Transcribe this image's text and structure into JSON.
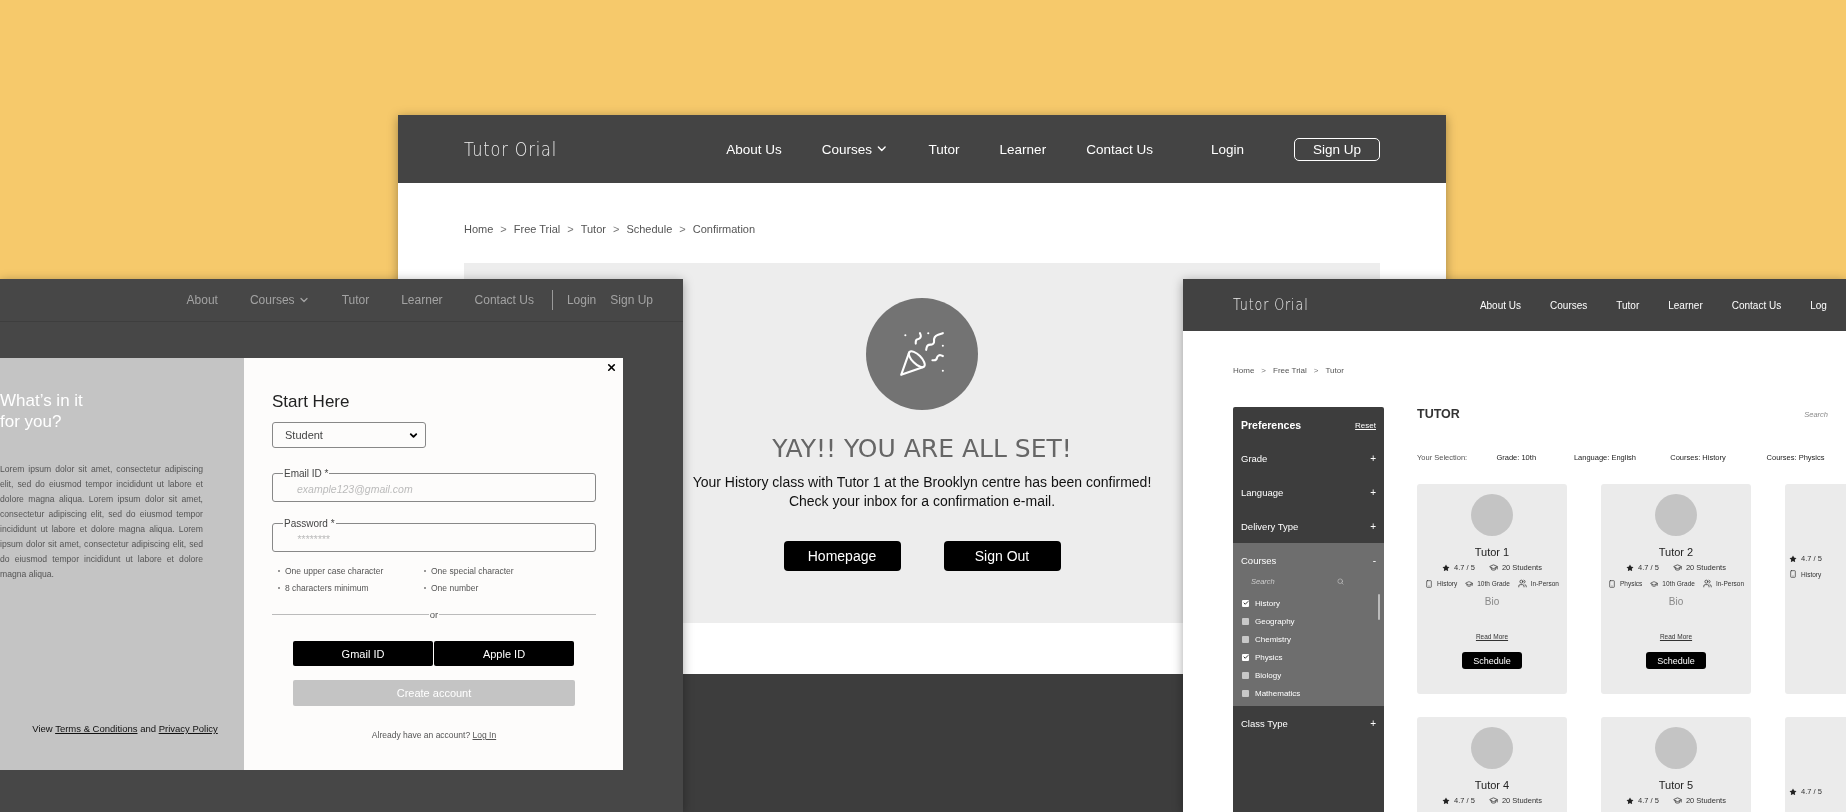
{
  "confirmation_page": {
    "logo": "Tutor Orial",
    "nav": [
      {
        "label": "About Us",
        "kind": "link"
      },
      {
        "label": "Courses",
        "kind": "dropdown"
      },
      {
        "label": "Tutor",
        "kind": "link"
      },
      {
        "label": "Learner",
        "kind": "link"
      },
      {
        "label": "Contact Us",
        "kind": "link"
      }
    ],
    "login": "Login",
    "signup": "Sign Up",
    "breadcrumb": [
      {
        "label": "Home",
        "kind": "link"
      },
      {
        "label": ">",
        "kind": "separator"
      },
      {
        "label": "Free Trial",
        "kind": "link"
      },
      {
        "label": ">",
        "kind": "separator"
      },
      {
        "label": "Tutor",
        "kind": "link"
      },
      {
        "label": ">",
        "kind": "separator"
      },
      {
        "label": "Schedule",
        "kind": "link"
      },
      {
        "label": ">",
        "kind": "separator"
      },
      {
        "label": "Confirmation",
        "kind": "link"
      }
    ],
    "title": "YAY!! YOU ARE ALL SET!",
    "message": [
      "Your History class with Tutor 1 at the Brooklyn centre has been confirmed!",
      "Check your inbox for a confirmation e-mail."
    ],
    "buttons": [
      "Homepage",
      "Sign Out"
    ]
  },
  "signup_page": {
    "nav": [
      {
        "label": "About",
        "kind": "link"
      },
      {
        "label": "Courses",
        "kind": "dropdown"
      },
      {
        "label": "Tutor",
        "kind": "link"
      },
      {
        "label": "Learner",
        "kind": "link"
      },
      {
        "label": "Contact Us",
        "kind": "link"
      }
    ],
    "login": "Login",
    "signup": "Sign Up",
    "promo": {
      "heading": [
        "What’s in it",
        "for you?"
      ],
      "body": "Lorem ipsum dolor sit amet, consectetur adipiscing elit, sed do eiusmod tempor incididunt ut labore et dolore magna aliqua. Lorem ipsum dolor sit amet, consectetur adipiscing elit, sed do eiusmod tempor incididunt ut labore et dolore magna aliqua. Lorem ipsum dolor sit amet, consectetur adipiscing elit, sed do eiusmod tempor incididunt ut labore et dolore magna aliqua.",
      "legal": {
        "before": "View",
        "terms": "Terms & Conditions",
        "middle": "and",
        "privacy": "Privacy Policy"
      }
    },
    "form": {
      "title": "Start Here",
      "role": "Student",
      "email": {
        "label": "Email ID *",
        "placeholder": "example123@gmail.com"
      },
      "password": {
        "label": "Password *",
        "placeholder": "********"
      },
      "rules": [
        "One upper case character",
        "One special character",
        "8 characters minimum",
        "One number"
      ],
      "divider": "or",
      "social": [
        "Gmail ID",
        "Apple ID"
      ],
      "submit": {
        "label": "Create account",
        "disabled": true
      },
      "login_prompt": "Already have an account?",
      "login_link": "Log In"
    }
  },
  "tutor_page": {
    "logo": "Tutor Orial",
    "nav": [
      "About Us",
      "Courses",
      "Tutor",
      "Learner",
      "Contact Us",
      "Log"
    ],
    "breadcrumb": [
      {
        "label": "Home",
        "kind": "link"
      },
      {
        "label": ">",
        "kind": "separator"
      },
      {
        "label": "Free Trial",
        "kind": "link"
      },
      {
        "label": ">",
        "kind": "separator"
      },
      {
        "label": "Tutor",
        "kind": "link"
      }
    ],
    "sidebar": {
      "title": "Preferences",
      "reset": "Reset",
      "sections": [
        {
          "label": "Grade",
          "toggle": "+",
          "expanded": false
        },
        {
          "label": "Language",
          "toggle": "+",
          "expanded": false
        },
        {
          "label": "Delivery Type",
          "toggle": "+",
          "expanded": false
        },
        {
          "label": "Courses",
          "toggle": "-",
          "expanded": true,
          "search_placeholder": "Search",
          "options": [
            {
              "label": "History",
              "checked": true
            },
            {
              "label": "Geography",
              "checked": false
            },
            {
              "label": "Chemistry",
              "checked": false
            },
            {
              "label": "Physics",
              "checked": true
            },
            {
              "label": "Biology",
              "checked": false
            },
            {
              "label": "Mathematics",
              "checked": false
            }
          ]
        },
        {
          "label": "Class Type",
          "toggle": "+",
          "expanded": false
        }
      ]
    },
    "title": "TUTOR",
    "search_placeholder": "Search",
    "selection_label": "Your Selection:",
    "selection": [
      "Grade: 10th",
      "Language: English",
      "Courses: History",
      "Courses: Physics"
    ],
    "cards": [
      {
        "kind": "full",
        "name": "Tutor 1",
        "rating": "4.7 / 5",
        "students": "20 Students",
        "subject": "History",
        "grade": "10th Grade",
        "mode": "In-Person",
        "bio": "Bio",
        "link": "Read More",
        "button": "Schedule"
      },
      {
        "kind": "full",
        "name": "Tutor 2",
        "rating": "4.7 / 5",
        "students": "20 Students",
        "subject": "Physics",
        "grade": "10th Grade",
        "mode": "In-Person",
        "bio": "Bio",
        "link": "Read More",
        "button": "Schedule"
      },
      {
        "kind": "partial",
        "rating": "4.7 / 5",
        "subject": "History"
      },
      {
        "kind": "full",
        "name": "Tutor 4",
        "rating": "4.7 / 5",
        "students": "20 Students"
      },
      {
        "kind": "full",
        "name": "Tutor 5",
        "rating": "4.7 / 5",
        "students": "20 Students"
      },
      {
        "kind": "partial",
        "rating": "4.7 / 5"
      }
    ]
  }
}
